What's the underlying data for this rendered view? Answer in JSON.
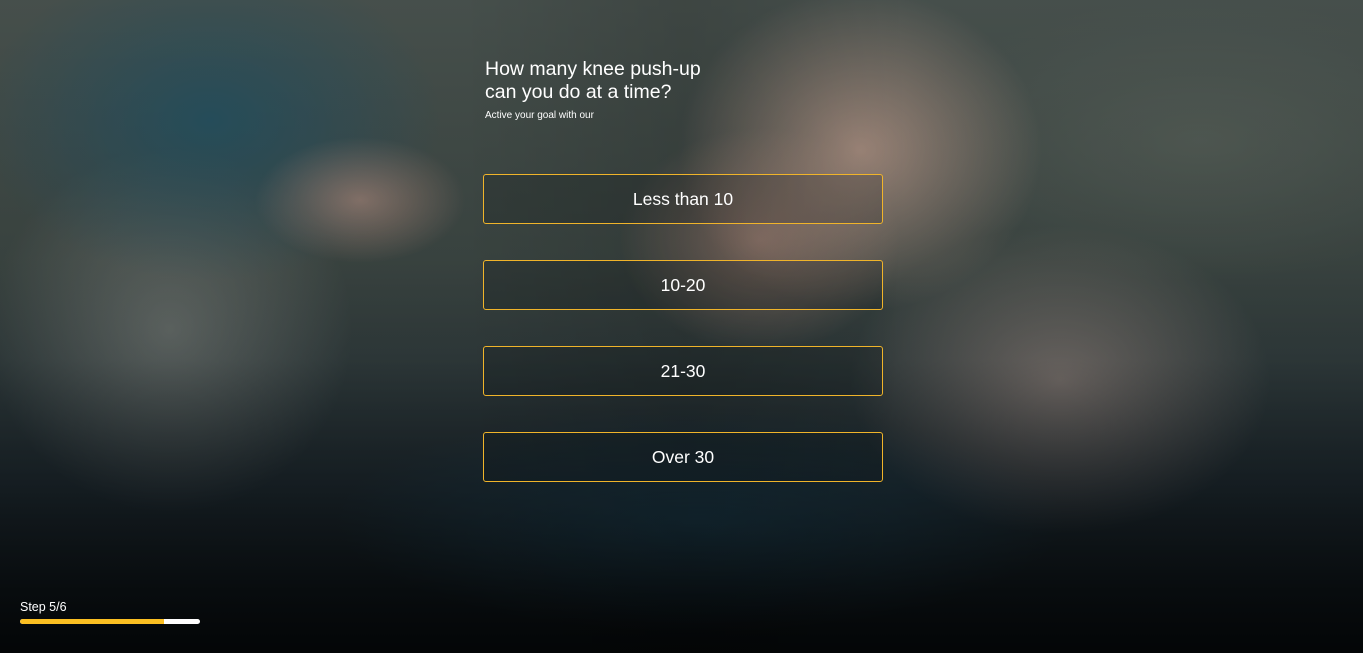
{
  "question": {
    "title": "How many knee push-up can you do at a time?",
    "subtitle": "Active your goal with our"
  },
  "options": [
    {
      "label": "Less than 10"
    },
    {
      "label": "10-20"
    },
    {
      "label": "21-30"
    },
    {
      "label": "Over 30"
    }
  ],
  "progress": {
    "step_label": "Step 5/6",
    "current_step": 5,
    "total_steps": 6,
    "fill_fraction": 0.8
  },
  "colors": {
    "accent": "#fbbf22",
    "option_border": "#f0b42a",
    "text": "#ffffff",
    "progress_track": "#ffffff"
  }
}
